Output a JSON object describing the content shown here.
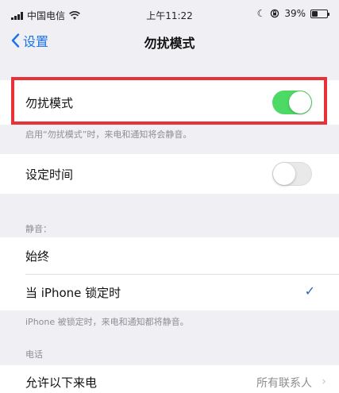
{
  "status_bar": {
    "carrier": "中国电信",
    "time": "上午11:22",
    "battery": "39%",
    "battery_level": 0.39
  },
  "nav": {
    "back_label": "设置",
    "title": "勿扰模式"
  },
  "dnd": {
    "label": "勿扰模式",
    "enabled": true,
    "footer": "启用“勿扰模式”时，来电和通知将会静音。"
  },
  "schedule": {
    "label": "设定时间",
    "enabled": false
  },
  "silence": {
    "header": "静音：",
    "options": [
      "始终",
      "当 iPhone 锁定时"
    ],
    "selected_index": 1,
    "footer": "iPhone 被锁定时，来电和通知都将静音。"
  },
  "phone": {
    "header": "电话",
    "allow_calls_label": "允许以下来电",
    "allow_calls_value": "所有联系人"
  },
  "colors": {
    "toggle_on": "#4cd964",
    "accent": "#1a73e8",
    "highlight": "#e8323a"
  }
}
